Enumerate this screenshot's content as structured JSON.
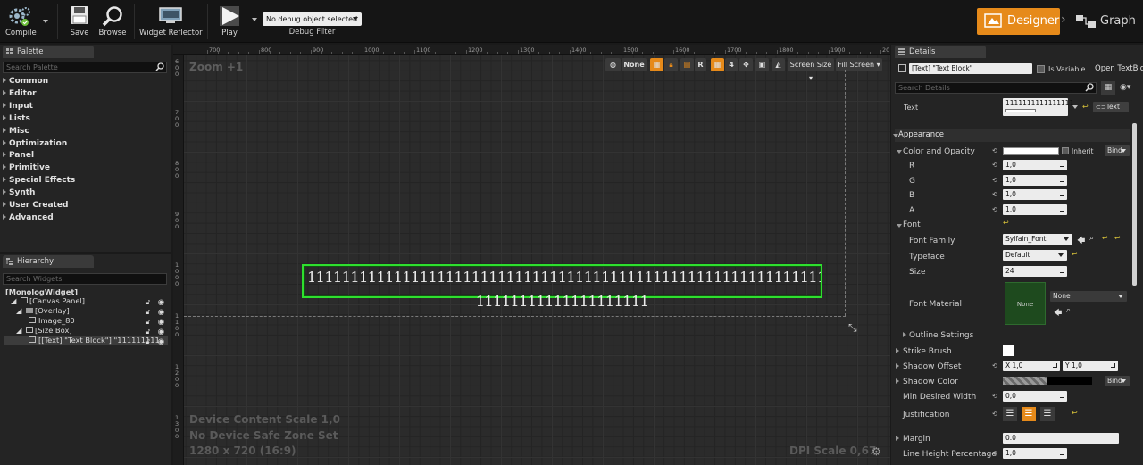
{
  "toolbar": {
    "compile": "Compile",
    "save": "Save",
    "browse": "Browse",
    "widget_reflector": "Widget Reflector",
    "play": "Play",
    "debug_object": "No debug object selected",
    "debug_filter": "Debug Filter",
    "designer": "Designer",
    "graph": "Graph"
  },
  "palette": {
    "tab": "Palette",
    "search_placeholder": "Search Palette",
    "categories": [
      "Common",
      "Editor",
      "Input",
      "Lists",
      "Misc",
      "Optimization",
      "Panel",
      "Primitive",
      "Special Effects",
      "Synth",
      "User Created",
      "Advanced"
    ]
  },
  "hierarchy": {
    "tab": "Hierarchy",
    "search_placeholder": "Search Widgets",
    "items": [
      {
        "label": "[MonologWidget]"
      },
      {
        "label": "[Canvas Panel]"
      },
      {
        "label": "[Overlay]"
      },
      {
        "label": "Image_80"
      },
      {
        "label": "[Size Box]"
      },
      {
        "label": "[[Text] \"Text Block\"] \"111111111"
      }
    ]
  },
  "canvas": {
    "zoom": "Zoom +1",
    "ruler_top": [
      "700",
      "800",
      "900",
      "1000",
      "1100",
      "1200",
      "1300",
      "1400",
      "1500",
      "1600",
      "1700",
      "1800",
      "1900",
      "20"
    ],
    "ruler_left": [
      "600",
      "700",
      "800",
      "900",
      "1000",
      "1100",
      "1200",
      "1300"
    ],
    "toolbar": {
      "none": "None",
      "r": "R",
      "four": "4",
      "screen_size": "Screen Size",
      "fill_screen": "Fill Screen"
    },
    "text_line1": "11111111111111111111111111111111111111111111111111111111111111",
    "text_line2": "11111111111111111111",
    "device_content_scale": "Device Content Scale 1,0",
    "safe_zone": "No Device Safe Zone Set",
    "resolution": "1280 x 720 (16:9)",
    "dpi_scale": "DPI Scale 0,67"
  },
  "details": {
    "tab": "Details",
    "name_value": "[Text] \"Text Block\"",
    "is_variable": "Is Variable",
    "open_text": "Open TextBlo",
    "search_placeholder": "Search Details",
    "text_label": "Text",
    "text_value": "1111111111111111",
    "text_button": "Text",
    "appearance": "Appearance",
    "color_label": "Color and Opacity",
    "inherit": "Inherit",
    "bind": "Bind",
    "r_label": "R",
    "r_value": "1,0",
    "g_label": "G",
    "g_value": "1,0",
    "b_label": "B",
    "b_value": "1,0",
    "a_label": "A",
    "a_value": "1,0",
    "font_label": "Font",
    "font_family_label": "Font Family",
    "font_family_value": "Sylfain_Font",
    "typeface_label": "Typeface",
    "typeface_value": "Default",
    "size_label": "Size",
    "size_value": "24",
    "font_material_label": "Font Material",
    "font_material_thumb": "None",
    "font_material_value": "None",
    "outline_label": "Outline Settings",
    "strike_label": "Strike Brush",
    "shadow_offset_label": "Shadow Offset",
    "shadow_x_label": "X",
    "shadow_x": "1,0",
    "shadow_y_label": "Y",
    "shadow_y": "1,0",
    "shadow_color_label": "Shadow Color",
    "min_width_label": "Min Desired Width",
    "min_width_value": "0,0",
    "justification_label": "Justification",
    "margin_label": "Margin",
    "margin_value": "0.0",
    "line_height_label": "Line Height Percentage",
    "line_height_value": "1,0"
  },
  "colors": {
    "accent": "#e68a1a",
    "selection": "#2ee02e"
  }
}
